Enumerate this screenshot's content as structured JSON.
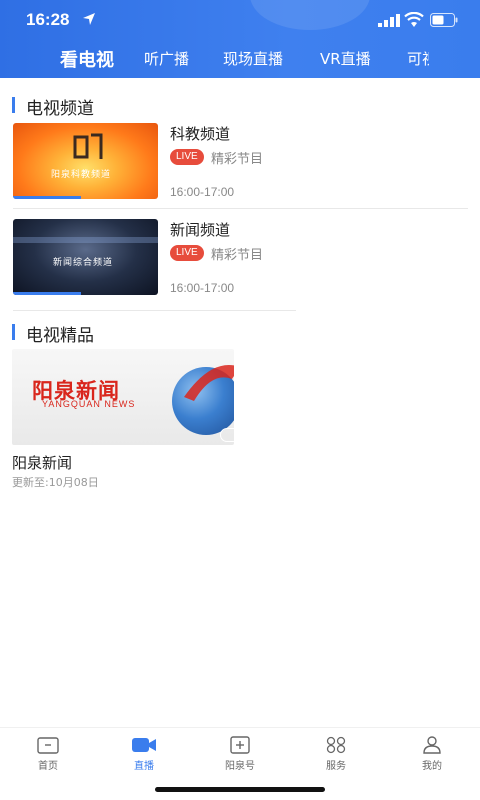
{
  "status_bar": {
    "time": "16:28"
  },
  "top_tabs": [
    {
      "label": "看电视",
      "active": true
    },
    {
      "label": "听广播",
      "active": false
    },
    {
      "label": "现场直播",
      "active": false
    },
    {
      "label": "VR直播",
      "active": false
    },
    {
      "label": "可视",
      "active": false
    }
  ],
  "tv_channels": {
    "title": "电视频道",
    "items": [
      {
        "name": "科教频道",
        "badge": "LIVE",
        "program": "精彩节目",
        "time": "16:00-17:00",
        "thumb_caption": "阳泉科教频道",
        "progress": 0.47
      },
      {
        "name": "新闻频道",
        "badge": "LIVE",
        "program": "精彩节目",
        "time": "16:00-17:00",
        "thumb_caption": "新闻综合频道",
        "progress": 0.47
      }
    ]
  },
  "tv_featured": {
    "title": "电视精品",
    "items": [
      {
        "thumb_logo": "阳泉新闻",
        "thumb_sub": "YANGQUAN NEWS",
        "title": "阳泉新闻",
        "updated": "更新至:10月08日"
      }
    ]
  },
  "bottom_nav": [
    {
      "label": "首页",
      "icon": "home-icon",
      "active": false
    },
    {
      "label": "直播",
      "icon": "video-camera-icon",
      "active": true
    },
    {
      "label": "阳泉号",
      "icon": "plus-square-icon",
      "active": false
    },
    {
      "label": "服务",
      "icon": "grid-icon",
      "active": false
    },
    {
      "label": "我的",
      "icon": "user-icon",
      "active": false
    }
  ],
  "colors": {
    "accent": "#3a7ded",
    "live": "#e74c3c"
  }
}
